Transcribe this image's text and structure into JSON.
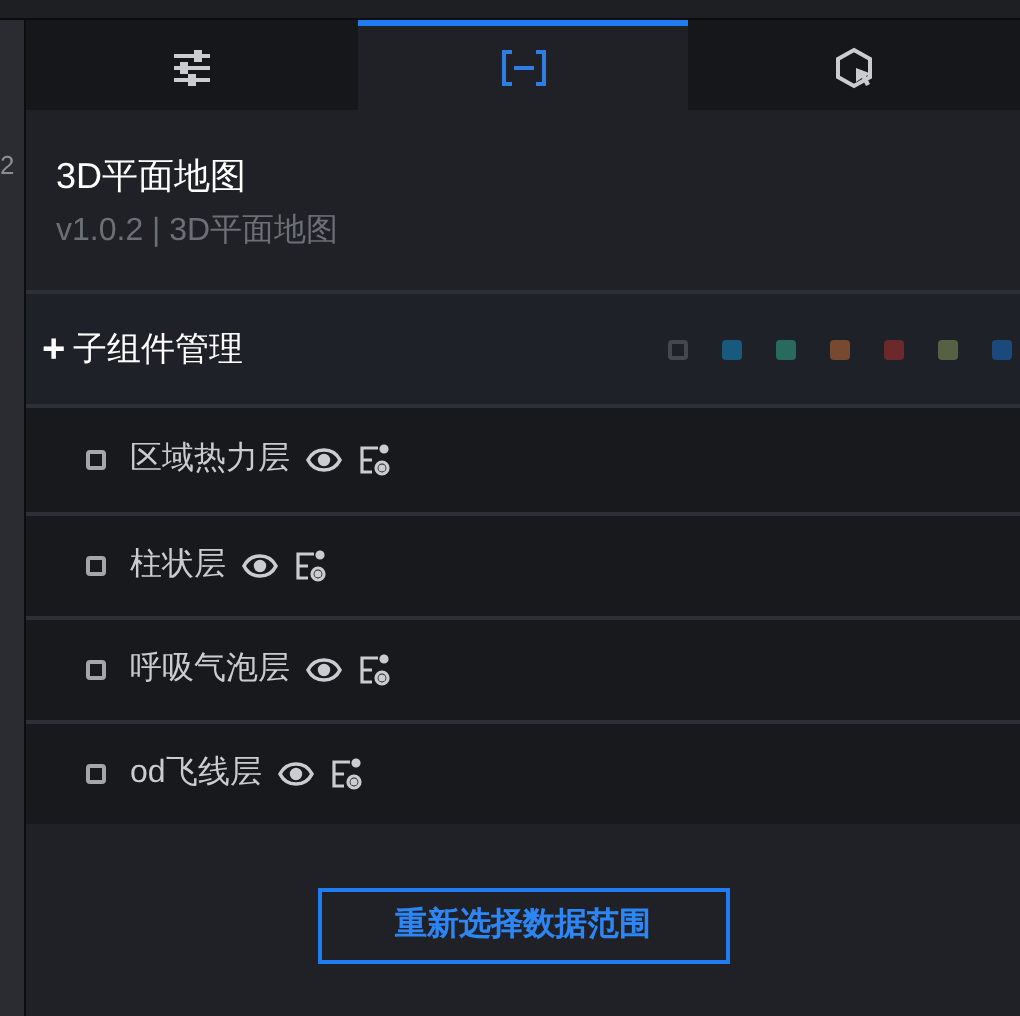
{
  "ruler": {
    "label": "2"
  },
  "tabs": [
    {
      "kind": "sliders",
      "selected": false
    },
    {
      "kind": "bracket",
      "selected": true
    },
    {
      "kind": "cursor",
      "selected": false
    }
  ],
  "header": {
    "title": "3D平面地图",
    "subtitle": "v1.0.2 | 3D平面地图"
  },
  "section": {
    "toggle": "+",
    "title": "子组件管理",
    "swatches": [
      {
        "kind": "outline",
        "color": "#44474e"
      },
      {
        "kind": "filled",
        "color": "#175a7e"
      },
      {
        "kind": "filled",
        "color": "#296a5e"
      },
      {
        "kind": "filled",
        "color": "#774a2f"
      },
      {
        "kind": "filled",
        "color": "#6c292b"
      },
      {
        "kind": "filled",
        "color": "#566042"
      },
      {
        "kind": "filled",
        "color": "#1b497c"
      }
    ]
  },
  "layers": [
    {
      "name": "区域热力层",
      "checked": false
    },
    {
      "name": "柱状层",
      "checked": false
    },
    {
      "name": "呼吸气泡层",
      "checked": false
    },
    {
      "name": "od飞线层",
      "checked": false
    }
  ],
  "button": {
    "label": "重新选择数据范围"
  }
}
